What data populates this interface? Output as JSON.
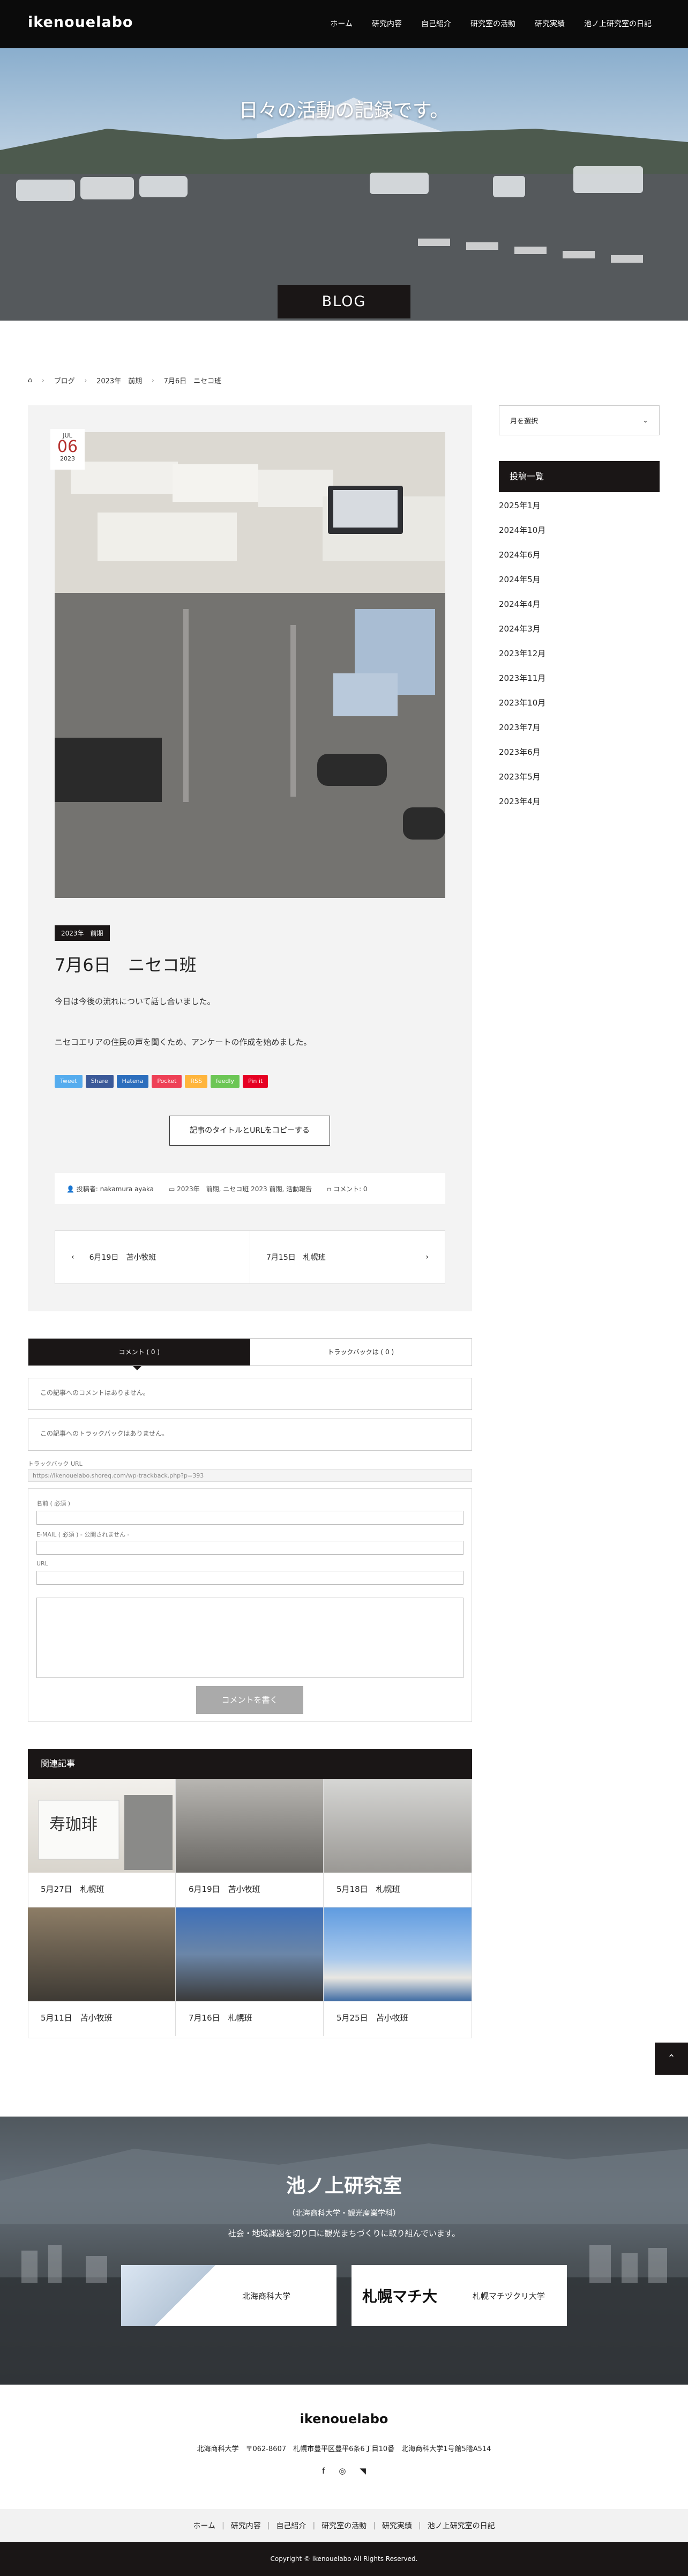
{
  "header": {
    "logo": "ikenouelabo",
    "nav": [
      "ホーム",
      "研究内容",
      "自己紹介",
      "研究室の活動",
      "研究実績",
      "池ノ上研究室の日記"
    ]
  },
  "hero": {
    "tagline": "日々の活動の記録です。",
    "band": "BLOG"
  },
  "breadcrumb": [
    "ブログ",
    "2023年　前期",
    "7月6日　ニセコ班"
  ],
  "post": {
    "date": {
      "month": "JUL",
      "day": "06",
      "year": "2023"
    },
    "category": "2023年　前期",
    "title": "7月6日　ニセコ班",
    "paragraphs": [
      "今日は今後の流れについて話し合いました。",
      "ニセコエリアの住民の声を聞くため、アンケートの作成を始めました。"
    ],
    "share_buttons": [
      {
        "label": "Tweet",
        "color": "#55acee"
      },
      {
        "label": "Share",
        "color": "#3b5998"
      },
      {
        "label": "Hatena",
        "color": "#2c6ebd"
      },
      {
        "label": "Pocket",
        "color": "#ee4056"
      },
      {
        "label": "RSS",
        "color": "#ffb53c"
      },
      {
        "label": "feedly",
        "color": "#6cc655"
      },
      {
        "label": "Pin it",
        "color": "#e60023"
      }
    ],
    "copy_button": "記事のタイトルとURLをコピーする",
    "meta": {
      "author": "投稿者: nakamura ayaka",
      "categories": "2023年　前期, ニセコ班 2023 前期, 活動報告",
      "comments": "コメント: 0"
    },
    "prev": "6月19日　苫小牧班",
    "next": "7月15日　札幌班"
  },
  "comments": {
    "tab_comments": "コメント ( 0 )",
    "tab_trackbacks": "トラックバックは ( 0 )",
    "no_comments": "この記事へのコメントはありません。",
    "no_trackbacks": "この記事へのトラックバックはありません。",
    "trackback_label": "トラックバック URL",
    "trackback_url": "https://ikenouelabo.shoreq.com/wp-trackback.php?p=393",
    "form_name": "名前 ( 必須 )",
    "form_email": "E-MAIL ( 必須 ) - 公開されません -",
    "form_url": "URL",
    "submit": "コメントを書く"
  },
  "related": {
    "heading": "関連記事",
    "items": [
      "5月27日　札幌班",
      "6月19日　苫小牧班",
      "5月18日　札幌班",
      "5月11日　苫小牧班",
      "7月16日　札幌班",
      "5月25日　苫小牧班"
    ]
  },
  "sidebar": {
    "select": "月を選択",
    "archive_heading": "投稿一覧",
    "archive": [
      "2025年1月",
      "2024年10月",
      "2024年6月",
      "2024年5月",
      "2024年4月",
      "2024年3月",
      "2023年12月",
      "2023年11月",
      "2023年10月",
      "2023年7月",
      "2023年6月",
      "2023年5月",
      "2023年4月"
    ]
  },
  "lab": {
    "title": "池ノ上研究室",
    "subtitle": "（北海商科大学・観光産業学科）",
    "desc": "社会・地域課題を切り口に観光まちづくりに取り組んでいます。",
    "links": [
      "北海商科大学",
      "札幌マチヅクリ大学"
    ],
    "logo_text": "札幌マチ大"
  },
  "footer": {
    "logo": "ikenouelabo",
    "address": "北海商科大学　〒062-8607　札幌市豊平区豊平6条6丁目10番　北海商科大学1号館5階A514",
    "nav": [
      "ホーム",
      "研究内容",
      "自己紹介",
      "研究室の活動",
      "研究実績",
      "池ノ上研究室の日記"
    ],
    "copyright": "Copyright © ikenouelabo All Rights Reserved."
  }
}
